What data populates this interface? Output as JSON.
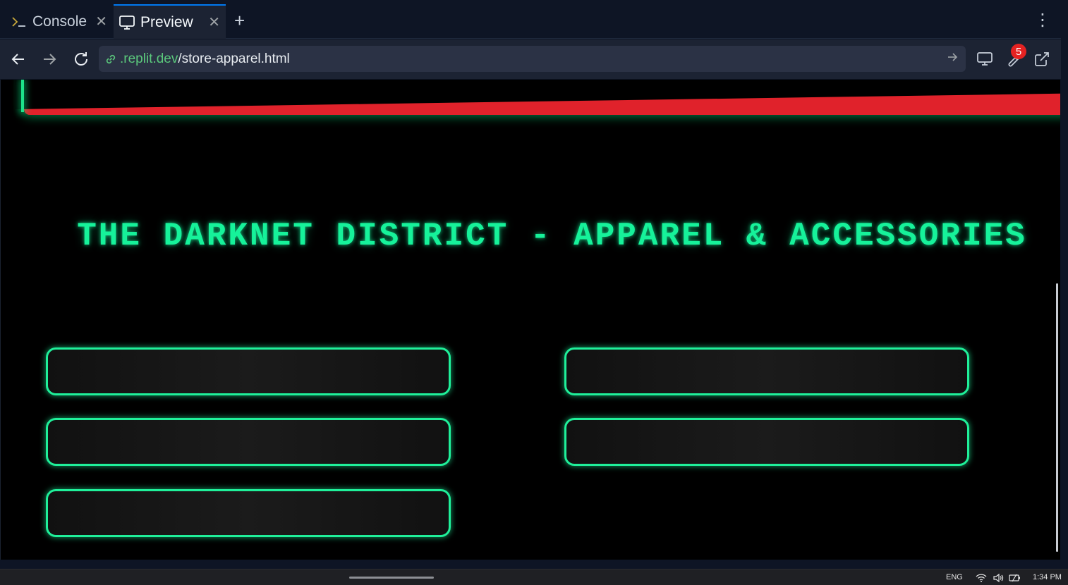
{
  "tabs": [
    {
      "label": "Console",
      "icon": "terminal-prompt-icon",
      "active": false
    },
    {
      "label": "Preview",
      "icon": "monitor-icon",
      "active": true
    }
  ],
  "address_bar": {
    "host": ".replit.dev",
    "path": "/store-apparel.html"
  },
  "devtools_badge": "5",
  "page": {
    "title": "THE DARKNET DISTRICT - APPAREL & ACCESSORIES",
    "product_card_count": 5
  },
  "taskbar": {
    "language": "ENG",
    "time": "1:34 PM"
  },
  "colors": {
    "neon_green": "#16f29a",
    "banner_red": "#e0222b",
    "tab_accent": "#0079f2",
    "host_green": "#5bc87c",
    "badge_red": "#e52222"
  }
}
